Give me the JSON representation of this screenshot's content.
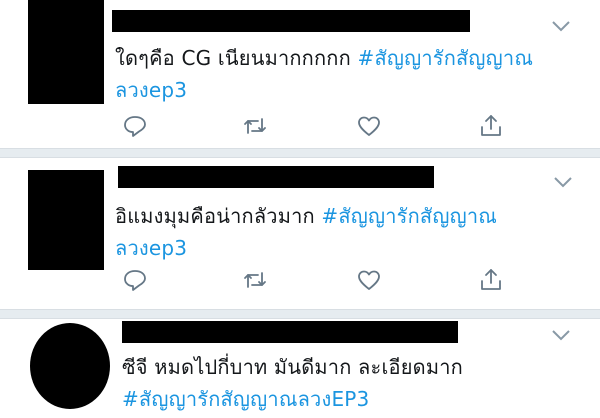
{
  "tweets": [
    {
      "text": "ใดๆคือ CG เนียนมากกกกก",
      "hashtag_1": "#สัญญารักสัญญาณ",
      "hashtag_2": "ลวงep3"
    },
    {
      "text": "อิแมงมุมคือน่ากลัวมาก",
      "hashtag_1": "#สัญญารักสัญญาณ",
      "hashtag_2": "ลวงep3"
    },
    {
      "text": "ซีจี หมดไปกี่บาท มันดีมาก ละเอียดมาก",
      "hashtag_1": "#สัญญารักสัญญาณลวงEP3"
    }
  ],
  "icons": {
    "reply": "reply-icon",
    "retweet": "retweet-icon",
    "like": "heart-icon",
    "share": "share-icon",
    "menu": "chevron-down-icon"
  },
  "colors": {
    "hashtag": "#1b95e0",
    "icon": "#657786",
    "separator": "#e6ecf0"
  }
}
